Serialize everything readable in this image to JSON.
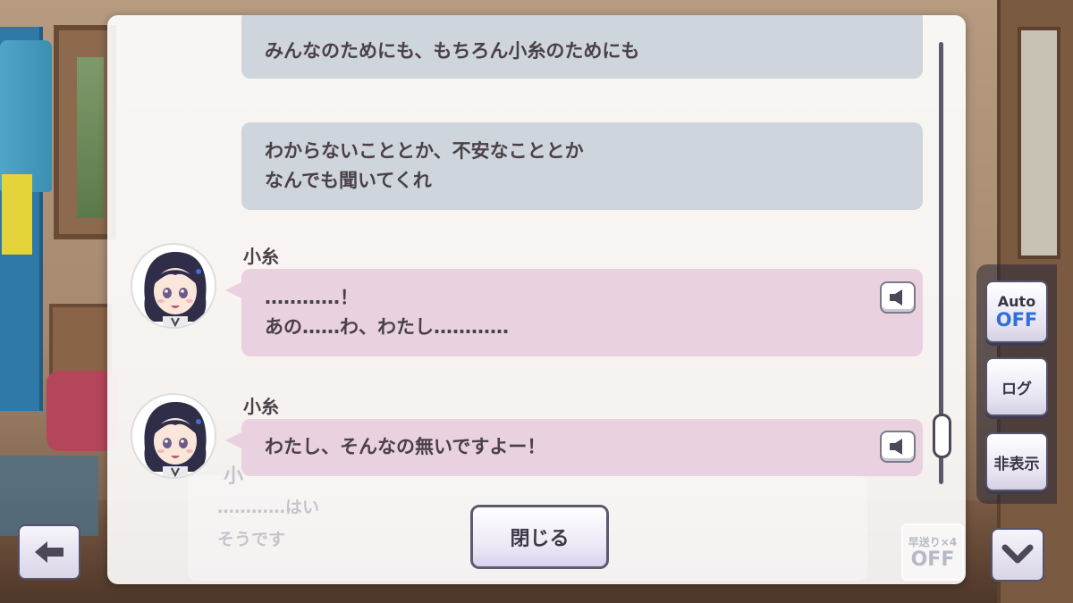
{
  "backlog": {
    "entries": [
      {
        "type": "narration",
        "lines": [
          "みんなのためにも、もちろん小糸のためにも"
        ]
      },
      {
        "type": "narration",
        "lines": [
          "わからないこととか、不安なこととか",
          "なんでも聞いてくれ"
        ]
      },
      {
        "type": "speech",
        "speaker": "小糸",
        "lines": [
          "…………！",
          "あの……わ、わたし…………"
        ],
        "voice_icon": "speaker-icon"
      },
      {
        "type": "speech",
        "speaker": "小糸",
        "lines": [
          "わたし、そんなの無いですよー！"
        ],
        "voice_icon": "speaker-icon"
      }
    ],
    "close_label": "閉じる"
  },
  "background_dialog": {
    "lines": [
      "…………はい",
      "そうです"
    ],
    "speaker_initial": "小"
  },
  "controls": {
    "auto_label": "Auto",
    "auto_state": "OFF",
    "log_label": "ログ",
    "hide_label": "非表示",
    "skip_label": "早送り×4",
    "skip_state": "OFF"
  },
  "icons": {
    "back": "left-arrow-icon",
    "down": "chevron-down-icon",
    "voice": "speaker-icon"
  },
  "colors": {
    "narration_bubble": "#cfd5dc",
    "speech_bubble": "#e9d1df",
    "auto_off": "#2f6fd6"
  }
}
